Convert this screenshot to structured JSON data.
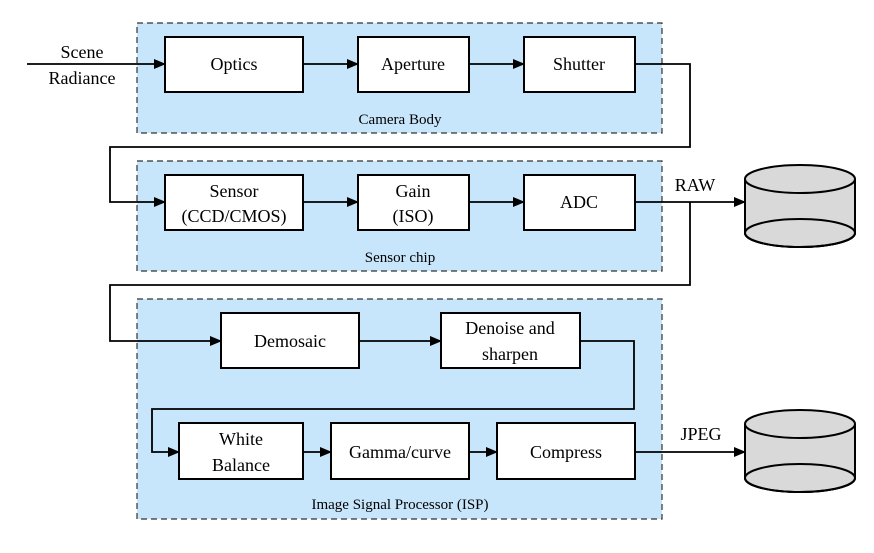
{
  "input": {
    "line1": "Scene",
    "line2": "Radiance"
  },
  "groups": {
    "camera_body": {
      "label": "Camera Body",
      "blocks": [
        "Optics",
        "Aperture",
        "Shutter"
      ]
    },
    "sensor_chip": {
      "label": "Sensor chip",
      "blocks": [
        [
          "Sensor",
          "(CCD/CMOS)"
        ],
        [
          "Gain",
          "(ISO)"
        ],
        [
          "ADC"
        ]
      ]
    },
    "isp": {
      "label": "Image Signal Processor (ISP)",
      "blocks": [
        [
          "Demosaic"
        ],
        [
          "Denoise and",
          "sharpen"
        ],
        [
          "White",
          "Balance"
        ],
        [
          "Gamma/curve"
        ],
        [
          "Compress"
        ]
      ]
    }
  },
  "outputs": {
    "raw": "RAW",
    "jpeg": "JPEG"
  },
  "colors": {
    "group_fill": "#c8e6fb",
    "storage_fill": "#d9d9d9"
  }
}
